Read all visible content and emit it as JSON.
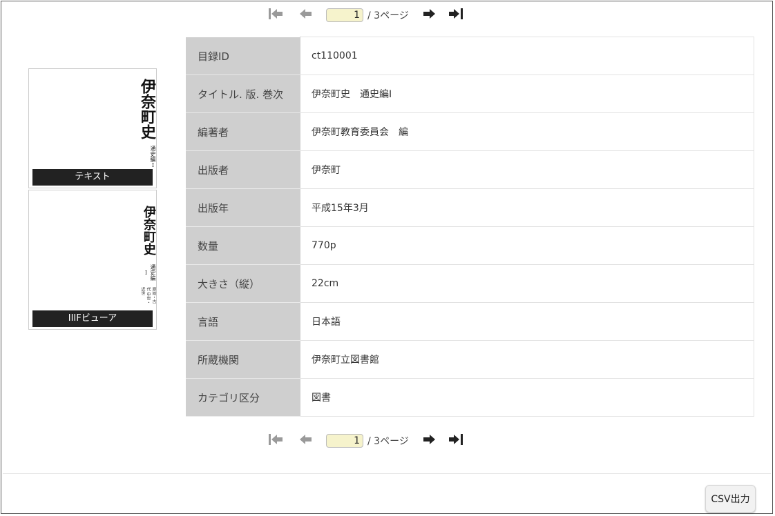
{
  "pager": {
    "first_icon": "skip-to-first-icon",
    "prev_icon": "arrow-left-icon",
    "next_icon": "arrow-right-icon",
    "last_icon": "skip-to-last-icon",
    "current_page": "1",
    "total_text": "/ 3ページ",
    "disabled_color": "#9a9a9a",
    "active_color": "#222222"
  },
  "thumbnails": [
    {
      "cover_title": "伊奈町史",
      "cover_subtitle": "通史編Ⅰ",
      "label": "テキスト"
    },
    {
      "cover_title": "伊奈町史",
      "cover_subtitle": "通史編Ⅰ",
      "cover_subtitle2": "原始・古代 中世・近世",
      "label": "IIIFビューア"
    }
  ],
  "record": [
    {
      "key": "目録ID",
      "value": "ct110001"
    },
    {
      "key": "タイトル. 版. 巻次",
      "value": "伊奈町史　通史編Ⅰ"
    },
    {
      "key": "編著者",
      "value": "伊奈町教育委員会　編"
    },
    {
      "key": "出版者",
      "value": "伊奈町"
    },
    {
      "key": "出版年",
      "value": "平成15年3月"
    },
    {
      "key": "数量",
      "value": "770p"
    },
    {
      "key": "大きさ（縦）",
      "value": "22cm"
    },
    {
      "key": "言語",
      "value": "日本語"
    },
    {
      "key": "所蔵機関",
      "value": "伊奈町立図書館"
    },
    {
      "key": "カテゴリ区分",
      "value": "図書"
    }
  ],
  "footer": {
    "csv_label": "CSV出力"
  },
  "colors": {
    "key_cell_bg": "#cfcfcf",
    "page_input_bg": "#f6f3cc",
    "label_bg": "#222222"
  }
}
